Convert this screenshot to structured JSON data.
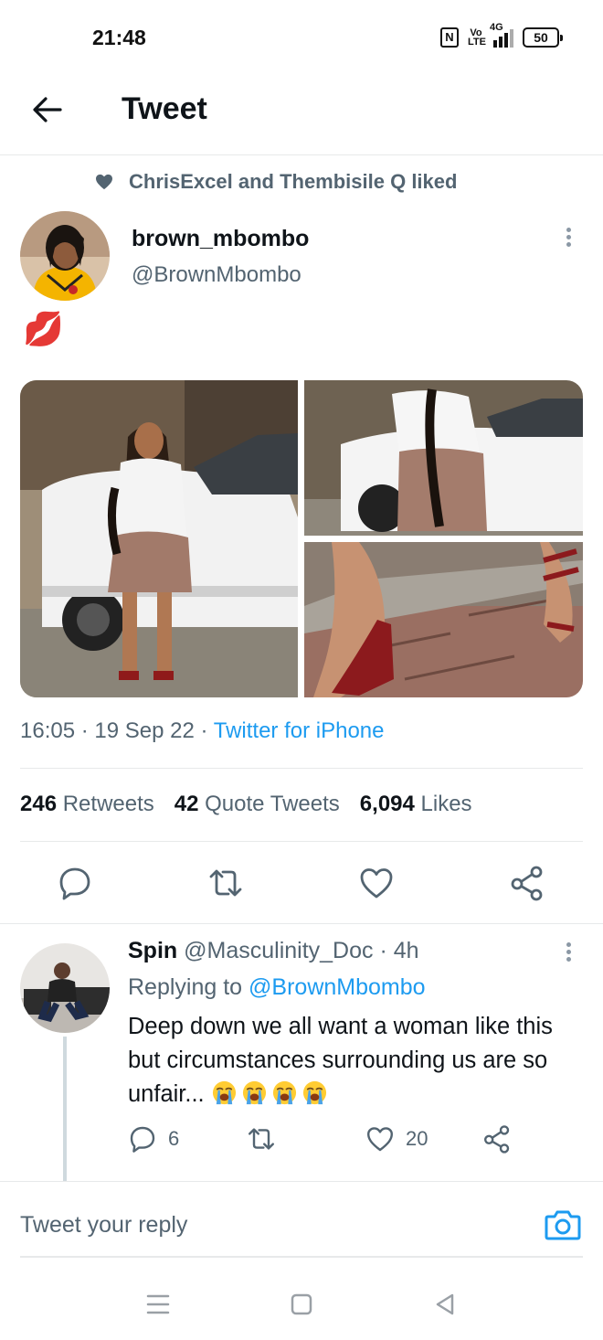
{
  "status_bar": {
    "time": "21:48",
    "nfc": "N",
    "volte": "Vo LTE",
    "network": "4G",
    "battery": "50"
  },
  "header": {
    "title": "Tweet",
    "back_icon": "arrow-left-icon"
  },
  "tweet": {
    "social_context": "ChrisExcel and Thembisile Q liked",
    "author_name": "brown_mbombo",
    "author_handle": "@BrownMbombo",
    "text": "💋",
    "time": "16:05",
    "date": "19 Sep 22",
    "source": "Twitter for iPhone",
    "stats": {
      "retweets_count": "246",
      "retweets_label": "Retweets",
      "quotes_count": "42",
      "quotes_label": "Quote Tweets",
      "likes_count": "6,094",
      "likes_label": "Likes"
    }
  },
  "reply": {
    "name": "Spin",
    "handle": "@Masculinity_Doc",
    "age": "4h",
    "replying_to_label": "Replying to",
    "replying_to_handle": "@BrownMbombo",
    "text": "Deep down we all want a woman like this but circumstances surrounding us are so unfair...",
    "emoji_count": 4,
    "reply_count": "6",
    "like_count": "20"
  },
  "composer": {
    "placeholder": "Tweet your reply"
  },
  "colors": {
    "accent": "#1d9bf0",
    "secondary_text": "#536471",
    "primary_text": "#0f1419",
    "divider": "#e7e9ea"
  }
}
